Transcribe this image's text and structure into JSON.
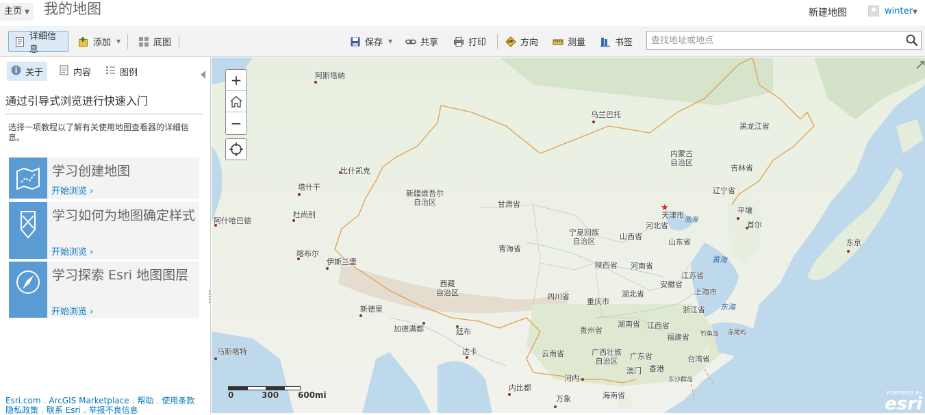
{
  "header": {
    "home_label": "主页",
    "map_title": "我的地图",
    "new_map_label": "新建地图",
    "user_name": "winter"
  },
  "toolbar": {
    "details_label": "详细信息",
    "add_label": "添加",
    "basemap_label": "底图",
    "save_label": "保存",
    "share_label": "共享",
    "print_label": "打印",
    "directions_label": "方向",
    "measure_label": "测量",
    "bookmarks_label": "书签",
    "search_placeholder": "查找地址或地点"
  },
  "side_panel": {
    "tabs": [
      {
        "label": "关于"
      },
      {
        "label": "内容"
      },
      {
        "label": "图例"
      }
    ],
    "heading": "通过引导式浏览进行快速入门",
    "description": "选择一项教程以了解有关使用地图查看器的详细信息。",
    "cards": [
      {
        "title": "学习创建地图",
        "link": "开始浏览 ›"
      },
      {
        "title": "学习如何为地图确定样式",
        "link": "开始浏览 ›"
      },
      {
        "title": "学习探索 Esri 地图图层",
        "link": "开始浏览 ›"
      }
    ],
    "footer_links": [
      "Esri.com",
      "ArcGIS Marketplace",
      "帮助",
      "使用条款",
      "隐私政策",
      "联系 Esri",
      "举报不良信息"
    ]
  },
  "map": {
    "labels": {
      "astana": "阿斯塔纳",
      "ulaanbaatar": "乌兰巴托",
      "heilongjiang": "黑龙江省",
      "inner_mongolia": "内蒙古\n自治区",
      "jilin": "吉林省",
      "bishkek": "比什凯克",
      "tashkent": "塔什干",
      "xinjiang": "新疆维吾尔\n自治区",
      "gansu": "甘肃省",
      "liaoning": "辽宁省",
      "dushanbe": "杜尚别",
      "ashgabat": "阿什哈巴德",
      "tianjin": "天津市",
      "bohai": "渤海",
      "pyongyang": "平壤",
      "hebei": "河北省",
      "seoul": "首尔",
      "ningxia": "宁夏回族\n自治区",
      "shanxi": "山西省",
      "shandong": "山东省",
      "tokyo": "东京",
      "kabul": "喀布尔",
      "qinghai": "青海省",
      "islamabad": "伊斯兰堡",
      "shaanxi": "陕西省",
      "henan": "河南省",
      "yellow_sea": "黄海",
      "jiangsu": "江苏省",
      "anhui": "安徽省",
      "tibet": "西藏\n自治区",
      "hubei": "湖北省",
      "shanghai": "上海市",
      "sichuan": "四川省",
      "chongqing": "重庆市",
      "east_sea": "东海",
      "zhejiang": "浙江省",
      "new_delhi": "新德里",
      "hunan": "湖南省",
      "jiangxi": "江西省",
      "kathmandu": "加德满都",
      "thimphu": "廷布",
      "guizhou": "贵州省",
      "fujian": "福建省",
      "diaoyu": "钓鱼岛",
      "chiwei": "赤尾屿",
      "muscat": "马斯喀特",
      "dhaka": "达卡",
      "yunnan": "云南省",
      "guangxi": "广西壮族\n自治区",
      "guangdong": "广东省",
      "taiwan": "台湾省",
      "macau": "澳门",
      "hongkong": "香港",
      "dongsha": "东沙群岛",
      "hanoi": "河内",
      "naypyidaw": "内比都",
      "vientiane": "万象",
      "hainan": "海南省"
    },
    "zoom_in": "+",
    "zoom_out": "−",
    "scale_labels": [
      "0",
      "300",
      "600mi"
    ],
    "logo_powered": "POWERED BY",
    "logo_brand": "esri"
  },
  "colors": {
    "accent": "#0079c1",
    "card_thumb": "#5a9bd3",
    "border_line": "#e0a050",
    "capital_star": "#e02020"
  }
}
